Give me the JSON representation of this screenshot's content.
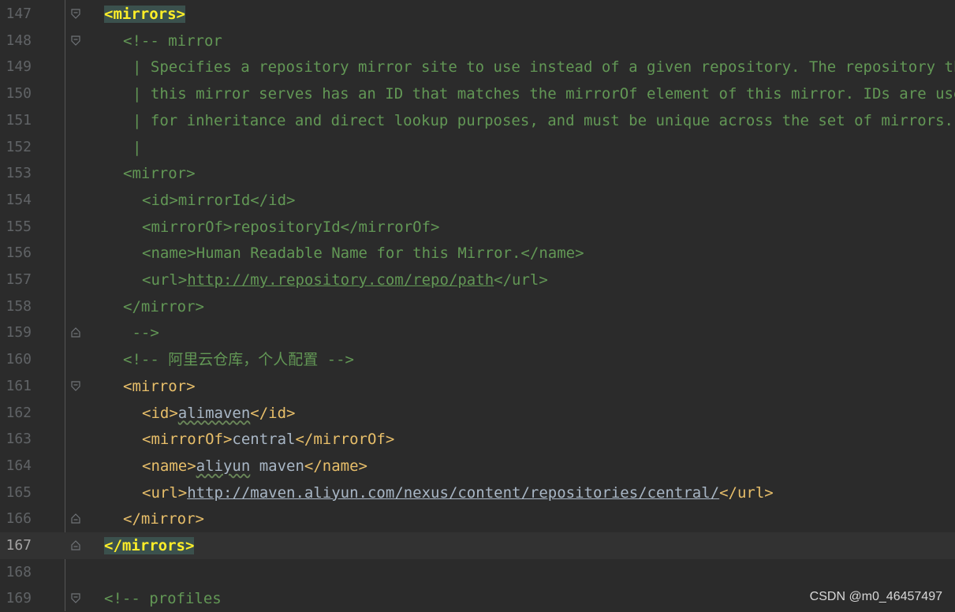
{
  "editor": {
    "current_line": "167",
    "lines": [
      {
        "n": "147",
        "segs": [
          [
            "match",
            "<mirrors>"
          ]
        ],
        "indent": 0,
        "fold": "open"
      },
      {
        "n": "148",
        "segs": [
          [
            "comment",
            "<!-- mirror"
          ]
        ],
        "indent": 1,
        "fold": "open"
      },
      {
        "n": "149",
        "segs": [
          [
            "comment",
            "| Specifies a repository mirror site to use instead of a given repository. The repository that"
          ]
        ],
        "indent": 1.5,
        "fold": ""
      },
      {
        "n": "150",
        "segs": [
          [
            "comment",
            "| this mirror serves has an ID that matches the mirrorOf element of this mirror. IDs are used"
          ]
        ],
        "indent": 1.5,
        "fold": ""
      },
      {
        "n": "151",
        "segs": [
          [
            "comment",
            "| for inheritance and direct lookup purposes, and must be unique across the set of mirrors."
          ]
        ],
        "indent": 1.5,
        "fold": ""
      },
      {
        "n": "152",
        "segs": [
          [
            "comment",
            "|"
          ]
        ],
        "indent": 1.5,
        "fold": ""
      },
      {
        "n": "153",
        "segs": [
          [
            "comment",
            "<mirror>"
          ]
        ],
        "indent": 1,
        "fold": ""
      },
      {
        "n": "154",
        "segs": [
          [
            "comment",
            "<id>mirrorId</id>"
          ]
        ],
        "indent": 2,
        "fold": ""
      },
      {
        "n": "155",
        "segs": [
          [
            "comment",
            "<mirrorOf>repositoryId</mirrorOf>"
          ]
        ],
        "indent": 2,
        "fold": ""
      },
      {
        "n": "156",
        "segs": [
          [
            "comment",
            "<name>Human Readable Name for this Mirror.</name>"
          ]
        ],
        "indent": 2,
        "fold": ""
      },
      {
        "n": "157",
        "segs": [
          [
            "comment",
            "<url>"
          ],
          [
            "commentlink",
            "http://my.repository.com/repo/path"
          ],
          [
            "comment",
            "</url>"
          ]
        ],
        "indent": 2,
        "fold": ""
      },
      {
        "n": "158",
        "segs": [
          [
            "comment",
            "</mirror>"
          ]
        ],
        "indent": 1,
        "fold": ""
      },
      {
        "n": "159",
        "segs": [
          [
            "comment",
            " -->"
          ]
        ],
        "indent": 1,
        "fold": "close"
      },
      {
        "n": "160",
        "segs": [
          [
            "comment",
            "<!-- 阿里云仓库，个人配置 -->"
          ]
        ],
        "indent": 1,
        "fold": ""
      },
      {
        "n": "161",
        "segs": [
          [
            "tag",
            "<mirror>"
          ]
        ],
        "indent": 1,
        "fold": "open"
      },
      {
        "n": "162",
        "segs": [
          [
            "tag",
            "<id>"
          ],
          [
            "squiggle",
            "alimaven"
          ],
          [
            "tag",
            "</id>"
          ]
        ],
        "indent": 2,
        "fold": ""
      },
      {
        "n": "163",
        "segs": [
          [
            "tag",
            "<mirrorOf>"
          ],
          [
            "text",
            "central"
          ],
          [
            "tag",
            "</mirrorOf>"
          ]
        ],
        "indent": 2,
        "fold": ""
      },
      {
        "n": "164",
        "segs": [
          [
            "tag",
            "<name>"
          ],
          [
            "squiggle",
            "aliyun"
          ],
          [
            "text",
            " maven"
          ],
          [
            "tag",
            "</name>"
          ]
        ],
        "indent": 2,
        "fold": ""
      },
      {
        "n": "165",
        "segs": [
          [
            "tag",
            "<url>"
          ],
          [
            "link",
            "http://maven.aliyun.com/nexus/content/repositories/central/"
          ],
          [
            "tag",
            "</url>"
          ]
        ],
        "indent": 2,
        "fold": ""
      },
      {
        "n": "166",
        "segs": [
          [
            "tag",
            "</mirror>"
          ]
        ],
        "indent": 1,
        "fold": "close"
      },
      {
        "n": "167",
        "segs": [
          [
            "match",
            "</mirrors>"
          ]
        ],
        "indent": 0,
        "fold": "close"
      },
      {
        "n": "168",
        "segs": [],
        "indent": 0,
        "fold": ""
      },
      {
        "n": "169",
        "segs": [
          [
            "comment",
            "<!-- profiles"
          ]
        ],
        "indent": 0,
        "fold": "open"
      }
    ]
  },
  "watermark": "CSDN @m0_46457497",
  "colors": {
    "background": "#2b2b2b",
    "tag": "#e8bf6a",
    "comment": "#629755",
    "text": "#a9b7c6",
    "match_bg": "#3b514d",
    "match_fg": "#ffef28"
  }
}
